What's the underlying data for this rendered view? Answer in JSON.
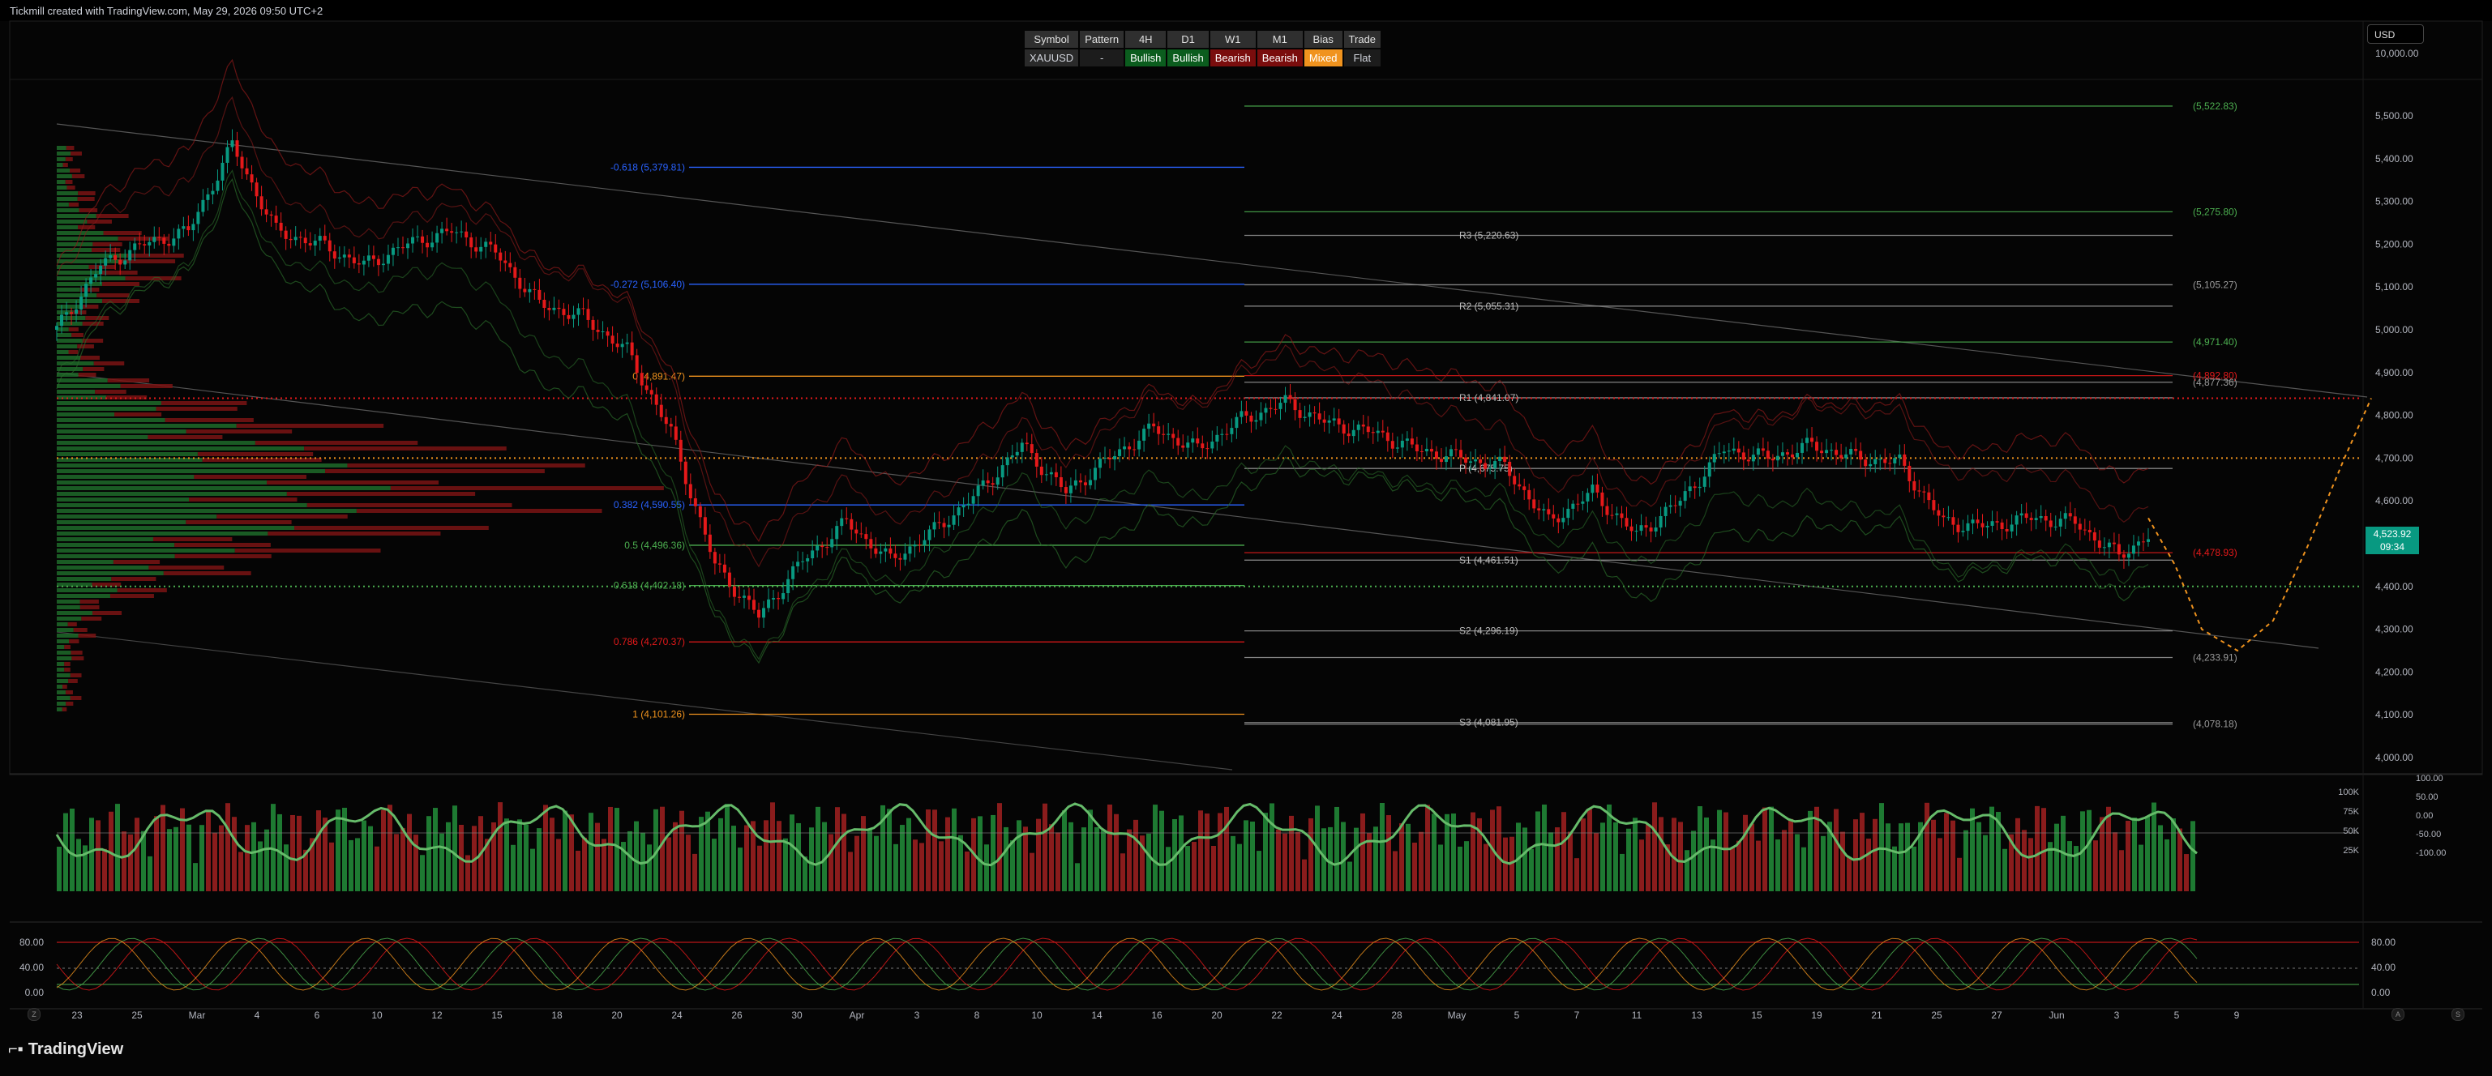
{
  "header": {
    "title": "Tickmill created with TradingView.com, May 29, 2026 09:50 UTC+2"
  },
  "footer": {
    "brand": "TradingView"
  },
  "currency": "USD",
  "price_tag": {
    "price": "4,523.92",
    "countdown": "09:34"
  },
  "stats_table": {
    "headers": [
      "Symbol",
      "Pattern",
      "4H",
      "D1",
      "W1",
      "M1",
      "Bias",
      "Trade"
    ],
    "row": [
      {
        "text": "XAUUSD",
        "bg": "#2a2a2a",
        "fg": "#d1d4dc"
      },
      {
        "text": "-",
        "bg": "#1c1c1c",
        "fg": "#d1d4dc"
      },
      {
        "text": "Bullish",
        "bg": "#0b5d1e",
        "fg": "#ffffff"
      },
      {
        "text": "Bullish",
        "bg": "#0b5d1e",
        "fg": "#ffffff"
      },
      {
        "text": "Bearish",
        "bg": "#7a0d0d",
        "fg": "#ffffff"
      },
      {
        "text": "Bearish",
        "bg": "#7a0d0d",
        "fg": "#ffffff"
      },
      {
        "text": "Mixed",
        "bg": "#f0931e",
        "fg": "#ffffff"
      },
      {
        "text": "Flat",
        "bg": "#1c1c1c",
        "fg": "#d1d4dc"
      }
    ]
  },
  "colors": {
    "up": "#089981",
    "down": "#e5191a",
    "fib": "#f0931e",
    "blue": "#2962ff",
    "green": "#4caf50",
    "grey": "#9a9a9a"
  },
  "chart_data": {
    "type": "candlestick",
    "symbol": "XAUUSD",
    "y_axis_labels": [
      "10,000.00",
      "5,500.00",
      "5,400.00",
      "5,300.00",
      "5,200.00",
      "5,100.00",
      "5,000.00",
      "4,900.00",
      "4,800.00",
      "4,700.00",
      "4,600.00",
      "4,500.00",
      "4,400.00",
      "4,300.00",
      "4,200.00",
      "4,100.00",
      "4,000.00"
    ],
    "ylim": [
      4000,
      5500
    ],
    "x_labels": [
      "23",
      "25",
      "Mar",
      "4",
      "6",
      "10",
      "12",
      "15",
      "18",
      "20",
      "24",
      "26",
      "30",
      "Apr",
      "3",
      "8",
      "10",
      "14",
      "16",
      "20",
      "22",
      "24",
      "28",
      "May",
      "5",
      "7",
      "11",
      "13",
      "15",
      "19",
      "21",
      "25",
      "27",
      "Jun",
      "3",
      "5",
      "9"
    ],
    "close_path": [
      [
        0,
        5000
      ],
      [
        3,
        5150
      ],
      [
        6,
        5200
      ],
      [
        9,
        5230
      ],
      [
        12,
        5430
      ],
      [
        15,
        5230
      ],
      [
        18,
        5200
      ],
      [
        21,
        5150
      ],
      [
        24,
        5200
      ],
      [
        27,
        5230
      ],
      [
        30,
        5180
      ],
      [
        33,
        5060
      ],
      [
        36,
        5030
      ],
      [
        39,
        4950
      ],
      [
        42,
        4760
      ],
      [
        45,
        4450
      ],
      [
        48,
        4330
      ],
      [
        51,
        4460
      ],
      [
        54,
        4550
      ],
      [
        57,
        4460
      ],
      [
        60,
        4530
      ],
      [
        63,
        4620
      ],
      [
        66,
        4730
      ],
      [
        69,
        4620
      ],
      [
        72,
        4700
      ],
      [
        75,
        4770
      ],
      [
        78,
        4720
      ],
      [
        81,
        4790
      ],
      [
        84,
        4830
      ],
      [
        87,
        4780
      ],
      [
        90,
        4760
      ],
      [
        93,
        4720
      ],
      [
        96,
        4700
      ],
      [
        99,
        4680
      ],
      [
        102,
        4550
      ],
      [
        105,
        4620
      ],
      [
        108,
        4520
      ],
      [
        111,
        4600
      ],
      [
        114,
        4720
      ],
      [
        117,
        4700
      ],
      [
        120,
        4730
      ],
      [
        123,
        4700
      ],
      [
        126,
        4690
      ],
      [
        129,
        4550
      ],
      [
        132,
        4540
      ],
      [
        135,
        4560
      ],
      [
        138,
        4550
      ],
      [
        141,
        4470
      ],
      [
        143,
        4520
      ]
    ],
    "price_levels": [
      {
        "label": "(5,522.83)",
        "value": 5522.83,
        "color": "#4caf50"
      },
      {
        "label": "(5,275.80)",
        "value": 5275.8,
        "color": "#4caf50"
      },
      {
        "label": "R3 (5,220.63)",
        "value": 5220.63,
        "color": "#9a9a9a"
      },
      {
        "label": "(5,105.27)",
        "value": 5105.27,
        "color": "#9a9a9a"
      },
      {
        "label": "R2 (5,055.31)",
        "value": 5055.31,
        "color": "#9a9a9a"
      },
      {
        "label": "(4,971.40)",
        "value": 4971.4,
        "color": "#4caf50"
      },
      {
        "label": "(4,892.80)",
        "value": 4892.8,
        "color": "#e5191a"
      },
      {
        "label": "(4,877.36)",
        "value": 4877.36,
        "color": "#9a9a9a"
      },
      {
        "label": "R1 (4,841.07)",
        "value": 4841.07,
        "color": "#9a9a9a"
      },
      {
        "label": "P (4,675.75)",
        "value": 4675.75,
        "color": "#9a9a9a"
      },
      {
        "label": "(4,478.93)",
        "value": 4478.93,
        "color": "#e5191a"
      },
      {
        "label": "S1 (4,461.51)",
        "value": 4461.51,
        "color": "#9a9a9a"
      },
      {
        "label": "S2 (4,296.19)",
        "value": 4296.19,
        "color": "#9a9a9a"
      },
      {
        "label": "(4,233.91)",
        "value": 4233.91,
        "color": "#9a9a9a"
      },
      {
        "label": "S3 (4,081.95)",
        "value": 4081.95,
        "color": "#9a9a9a"
      },
      {
        "label": "(4,078.18)",
        "value": 4078.18,
        "color": "#9a9a9a"
      }
    ],
    "fib_levels": [
      {
        "label": "-0.618 (5,379.81)",
        "value": 5379.81,
        "color": "#2962ff"
      },
      {
        "label": "-0.272 (5,106.40)",
        "value": 5106.4,
        "color": "#2962ff"
      },
      {
        "label": "0 (4,891.47)",
        "value": 4891.47,
        "color": "#f0931e"
      },
      {
        "label": "0.382 (4,590.55)",
        "value": 4590.55,
        "color": "#2962ff"
      },
      {
        "label": "0.5 (4,496.36)",
        "value": 4496.36,
        "color": "#4caf50"
      },
      {
        "label": "0.618 (4,402.18)",
        "value": 4402.18,
        "color": "#4caf50"
      },
      {
        "label": "0.786 (4,270.37)",
        "value": 4270.37,
        "color": "#e5191a"
      },
      {
        "label": "1 (4,101.26)",
        "value": 4101.26,
        "color": "#f0931e"
      }
    ],
    "dotted_levels": [
      4840,
      4700,
      4400
    ],
    "projection": [
      [
        0,
        4560
      ],
      [
        3,
        4450
      ],
      [
        6,
        4300
      ],
      [
        10,
        4250
      ],
      [
        14,
        4320
      ],
      [
        18,
        4500
      ],
      [
        22,
        4700
      ],
      [
        25,
        4840
      ]
    ],
    "osc1_axis": [
      "100K",
      "75K",
      "50K",
      "25K"
    ],
    "osc1_right": [
      "100.00",
      "50.00",
      "0.00",
      "-50.00",
      "-100.00"
    ],
    "osc2_axis": [
      "80.00",
      "40.00",
      "0.00"
    ]
  }
}
